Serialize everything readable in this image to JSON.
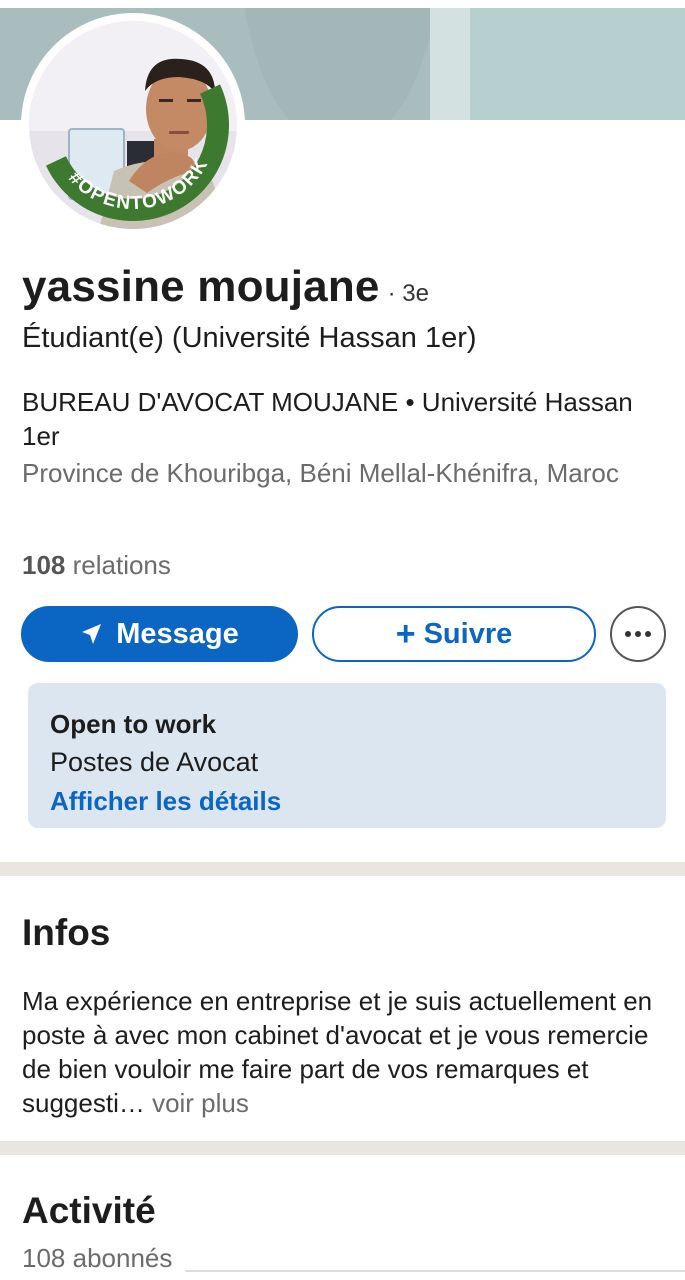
{
  "profile": {
    "name": "yassine moujane",
    "degree": "· 3e",
    "headline": "Étudiant(e) (Université Hassan 1er)",
    "company_line": "BUREAU D'AVOCAT MOUJANE • Université Hassan 1er",
    "location": "Province de Khouribga, Béni Mellal-Khénifra, Maroc",
    "relations_count": "108",
    "relations_label": " relations",
    "badge": "#OPENTOWORK"
  },
  "actions": {
    "message_label": "Message",
    "follow_label": "Suivre",
    "follow_icon": "+",
    "more_icon": "•••"
  },
  "open_to_work": {
    "title": "Open to work",
    "positions": "Postes de Avocat",
    "details_link": "Afficher les détails"
  },
  "infos": {
    "title": "Infos",
    "text": "Ma expérience en entreprise et je suis actuellement en poste à avec mon cabinet d'avocat et je vous remercie de bien vouloir me faire part de vos remarques et suggesti…",
    "more_label": " voir plus"
  },
  "activity": {
    "title": "Activité",
    "followers": "108 abonnés"
  },
  "colors": {
    "accent": "#0a66c2",
    "otw_green": "#2e7d32",
    "card_bg": "#dce6f1",
    "divider": "#e9e6df"
  }
}
